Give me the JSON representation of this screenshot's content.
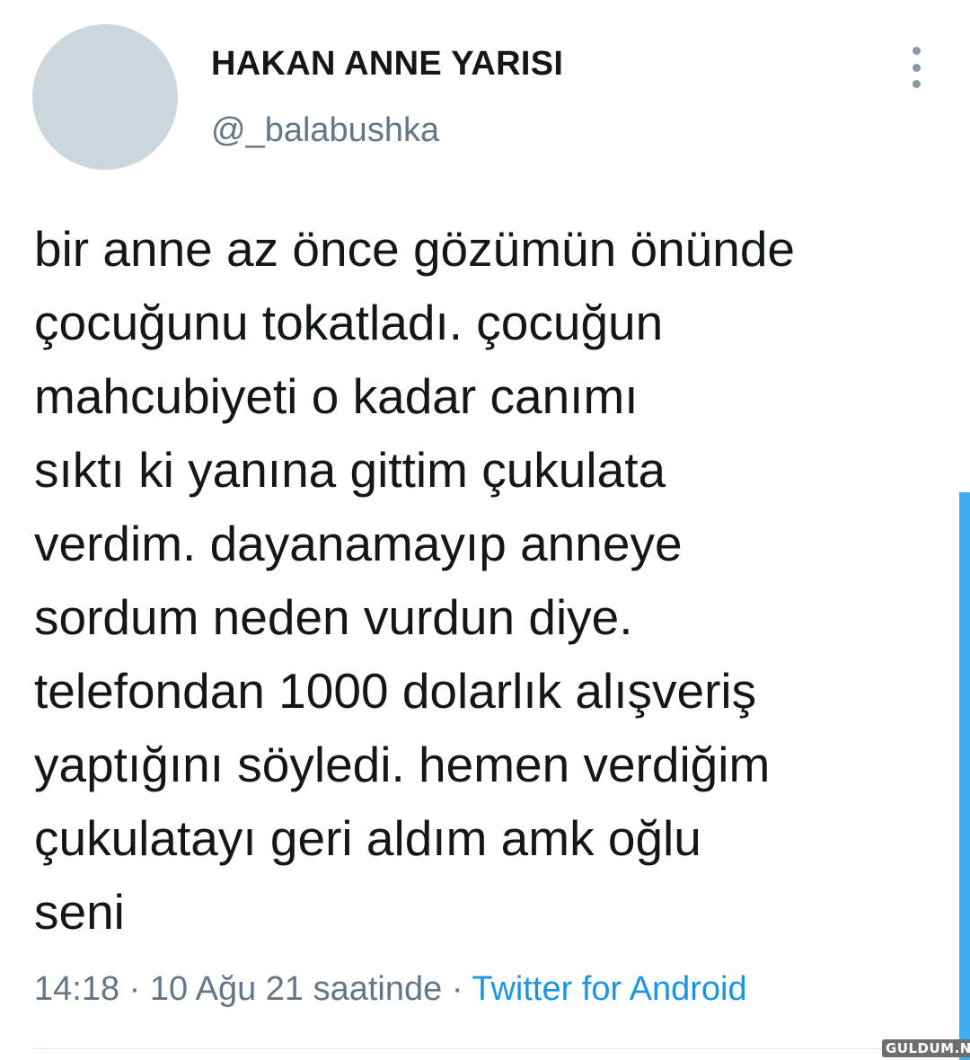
{
  "user": {
    "display_name": "HAKAN ANNE YARISI",
    "handle": "@_balabushka"
  },
  "tweet": {
    "lines": [
      "bir anne az önce gözümün önünde",
      "çocuğunu tokatladı. çocuğun",
      "mahcubiyeti o kadar canımı",
      "sıktı ki yanına gittim çukulata",
      "verdim. dayanamayıp anneye",
      "sordum neden vurdun diye.",
      "telefondan 1000 dolarlık alışveriş",
      "yaptığını söyledi. hemen verdiğim",
      "çukulatayı geri aldım amk oğlu",
      "seni"
    ],
    "time": "14:18",
    "separator": "·",
    "date": "10 Ağu 21 saatinde",
    "source": "Twitter for Android"
  },
  "icons": {
    "more": "vertical-ellipsis-icon",
    "avatar": "avatar-placeholder"
  },
  "colors": {
    "text": "#14171a",
    "secondary": "#657786",
    "link": "#1b95e0",
    "avatar": "#ccd6dd",
    "scrollbar": "#1da1f2"
  },
  "watermark": "GULDUM.NET"
}
